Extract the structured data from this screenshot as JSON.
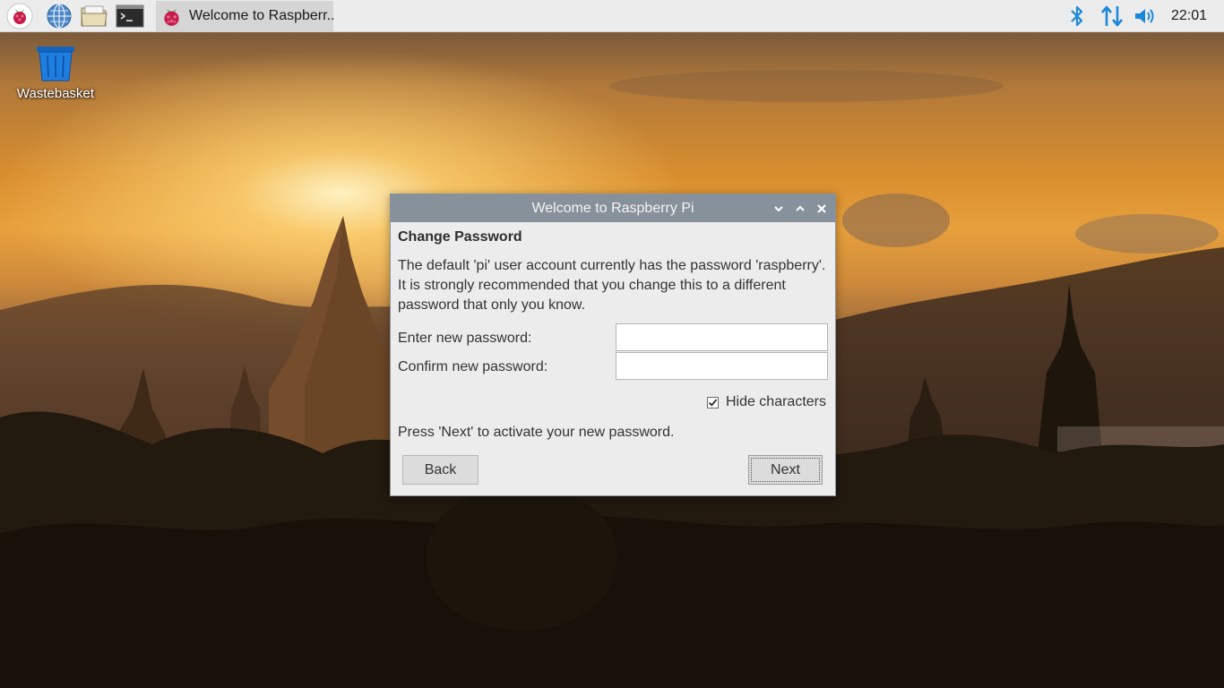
{
  "taskbar": {
    "launchers": [
      {
        "name": "raspberry-menu",
        "icon": "raspberry-icon"
      },
      {
        "name": "web-browser",
        "icon": "globe-icon"
      },
      {
        "name": "file-manager",
        "icon": "folder-icon"
      },
      {
        "name": "terminal",
        "icon": "terminal-icon"
      }
    ],
    "task_label": "Welcome to Raspberr...",
    "tray": {
      "bluetooth_icon": "bluetooth-icon",
      "network_icon": "network-arrows-icon",
      "volume_icon": "speaker-volume-icon",
      "clock": "22:01"
    },
    "accent": "#1e88d8"
  },
  "desktop": {
    "icons": [
      {
        "label": "Wastebasket",
        "icon": "wastebasket-icon"
      }
    ]
  },
  "dialog": {
    "title": "Welcome to Raspberry Pi",
    "heading": "Change Password",
    "description_lines": [
      "The default 'pi' user account currently has the password 'raspberry'.",
      "It is strongly recommended that you change this to a different",
      "password that only you know."
    ],
    "fields": [
      {
        "label": "Enter new password:",
        "value": ""
      },
      {
        "label": "Confirm new password:",
        "value": ""
      }
    ],
    "hide_characters": {
      "label": "Hide characters",
      "checked": true
    },
    "hint": "Press 'Next' to activate your new password.",
    "buttons": {
      "back": "Back",
      "next": "Next"
    }
  }
}
